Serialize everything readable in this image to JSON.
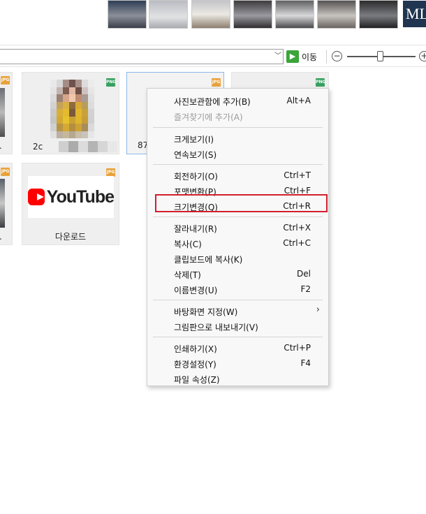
{
  "top_strip": {
    "thumbnails": [
      {
        "name": "bedroom-thumb-1",
        "c1": "#2d3e55",
        "c2": "#8b8f98"
      },
      {
        "name": "bedroom-thumb-2",
        "c1": "#b9bcc2",
        "c2": "#e2e2e4"
      },
      {
        "name": "bedroom-thumb-3",
        "c1": "#c4c4c8",
        "c2": "#8e8070"
      },
      {
        "name": "bedroom-thumb-4",
        "c1": "#3c3a3c",
        "c2": "#9a9aa0"
      },
      {
        "name": "bedroom-thumb-5",
        "c1": "#5f5f62",
        "c2": "#d9d9db"
      },
      {
        "name": "bedroom-thumb-6",
        "c1": "#565252",
        "c2": "#c7c3bf"
      },
      {
        "name": "bedroom-thumb-7",
        "c1": "#2b2b2d",
        "c2": "#7b7c80"
      }
    ],
    "logo_text": "ML"
  },
  "toolbar": {
    "go_label": "이동",
    "dropdown_glyph": "﹀",
    "go_glyph": "▶",
    "zoom_out_glyph": "−",
    "zoom_in_glyph": "+",
    "zoom_level": 0.45
  },
  "gallery": {
    "tiles": [
      {
        "caption": "2c"
      },
      {
        "caption": "87"
      },
      {
        "caption": "다운로드"
      },
      {
        "caption": "."
      },
      {
        "caption": "."
      }
    ],
    "badges": {
      "jpg": "JPG",
      "png": "PNG"
    },
    "youtube_text": "YouTube"
  },
  "context_menu": {
    "items": [
      {
        "label": "사진보관함에 추가(B)",
        "shortcut": "Alt+A"
      },
      {
        "label": "즐겨찾기에 추가(A)",
        "shortcut": ""
      },
      {
        "label": "크게보기(I)",
        "shortcut": ""
      },
      {
        "label": "연속보기(S)",
        "shortcut": ""
      },
      {
        "label": "회전하기(O)",
        "shortcut": "Ctrl+T"
      },
      {
        "label": "포맷변환(P)",
        "shortcut": "Ctrl+F"
      },
      {
        "label": "크기변경(Q)",
        "shortcut": "Ctrl+R"
      },
      {
        "label": "잘라내기(R)",
        "shortcut": "Ctrl+X"
      },
      {
        "label": "복사(C)",
        "shortcut": "Ctrl+C"
      },
      {
        "label": "클립보드에 복사(K)",
        "shortcut": ""
      },
      {
        "label": "삭제(T)",
        "shortcut": "Del"
      },
      {
        "label": "이름변경(U)",
        "shortcut": "F2"
      },
      {
        "label": "바탕화면 지정(W)",
        "shortcut": ""
      },
      {
        "label": "그림판으로 내보내기(V)",
        "shortcut": ""
      },
      {
        "label": "인쇄하기(X)",
        "shortcut": "Ctrl+P"
      },
      {
        "label": "환경설정(Y)",
        "shortcut": "F4"
      },
      {
        "label": "파일 속성(Z)",
        "shortcut": ""
      }
    ],
    "submenu_arrow": "›",
    "highlight_color": "#d21f2c"
  }
}
